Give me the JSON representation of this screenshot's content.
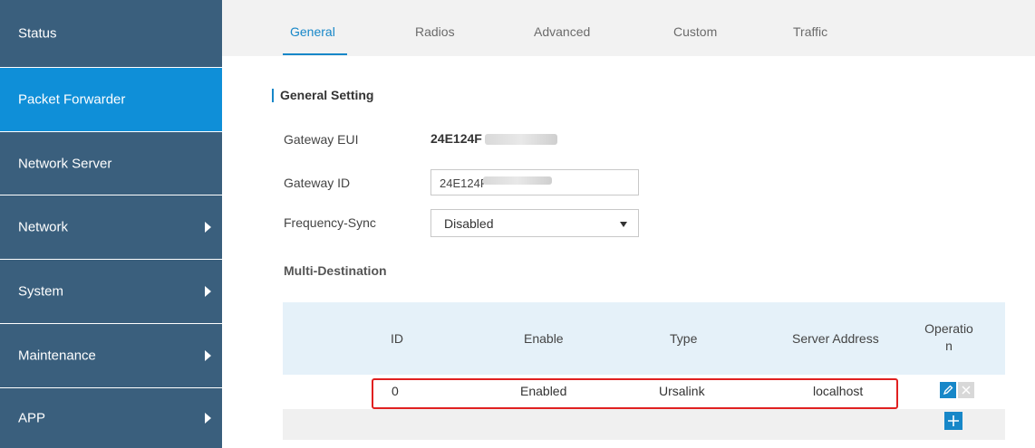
{
  "sidebar": {
    "items": [
      {
        "label": "Status",
        "has_arrow": false
      },
      {
        "label": "Packet Forwarder",
        "has_arrow": false,
        "active": true
      },
      {
        "label": "Network Server",
        "has_arrow": false
      },
      {
        "label": "Network",
        "has_arrow": true
      },
      {
        "label": "System",
        "has_arrow": true
      },
      {
        "label": "Maintenance",
        "has_arrow": true
      },
      {
        "label": "APP",
        "has_arrow": true
      }
    ]
  },
  "tabs": [
    {
      "label": "General",
      "active": true
    },
    {
      "label": "Radios"
    },
    {
      "label": "Advanced"
    },
    {
      "label": "Custom"
    },
    {
      "label": "Traffic"
    }
  ],
  "general_setting": {
    "title": "General Setting",
    "gateway_eui": {
      "label": "Gateway EUI",
      "value": "24E124F"
    },
    "gateway_id": {
      "label": "Gateway ID",
      "value": "24E124F"
    },
    "frequency_sync": {
      "label": "Frequency-Sync",
      "value": "Disabled"
    }
  },
  "multi_destination": {
    "title": "Multi-Destination",
    "columns": [
      "ID",
      "Enable",
      "Type",
      "Server Address",
      "Operation"
    ],
    "rows": [
      {
        "id": "0",
        "enable": "Enabled",
        "type": "Ursalink",
        "server_address": "localhost"
      }
    ]
  },
  "colors": {
    "sidebar_bg": "#3a5f7d",
    "sidebar_active": "#0f8fd8",
    "accent": "#1787c8",
    "highlight_border": "#e02020"
  }
}
